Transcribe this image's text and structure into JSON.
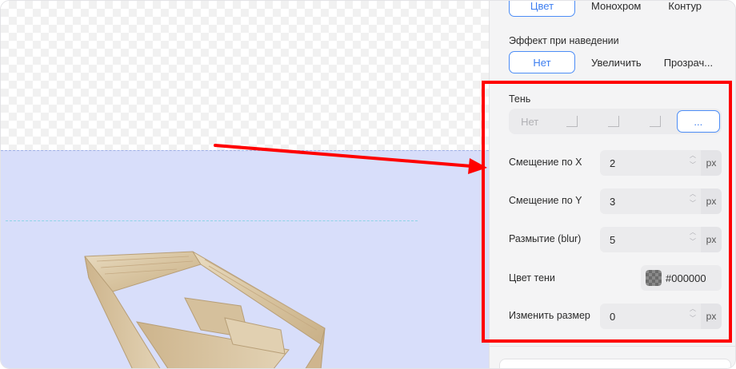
{
  "canvas": {},
  "panel": {
    "color_mode": {
      "options": [
        "Цвет",
        "Монохром",
        "Контур"
      ],
      "selected": "Цвет"
    },
    "hover_effect": {
      "label": "Эффект при наведении",
      "options": [
        "Нет",
        "Увеличить",
        "Прозрач..."
      ],
      "selected": "Нет"
    },
    "shadow": {
      "label": "Тень",
      "options": [
        "Нет",
        "",
        "",
        "",
        "..."
      ],
      "selected": "..."
    },
    "offset_x": {
      "label": "Смещение по X",
      "value": "2",
      "unit": "px"
    },
    "offset_y": {
      "label": "Смещение по Y",
      "value": "3",
      "unit": "px"
    },
    "blur": {
      "label": "Размытие (blur)",
      "value": "5",
      "unit": "px"
    },
    "shadow_color": {
      "label": "Цвет тени",
      "value": "#000000"
    },
    "resize": {
      "label": "Изменить размер",
      "value": "0",
      "unit": "px"
    }
  },
  "colors": {
    "accent": "#4c8df6",
    "highlight": "#ff0000",
    "selection": "#d8defa"
  }
}
